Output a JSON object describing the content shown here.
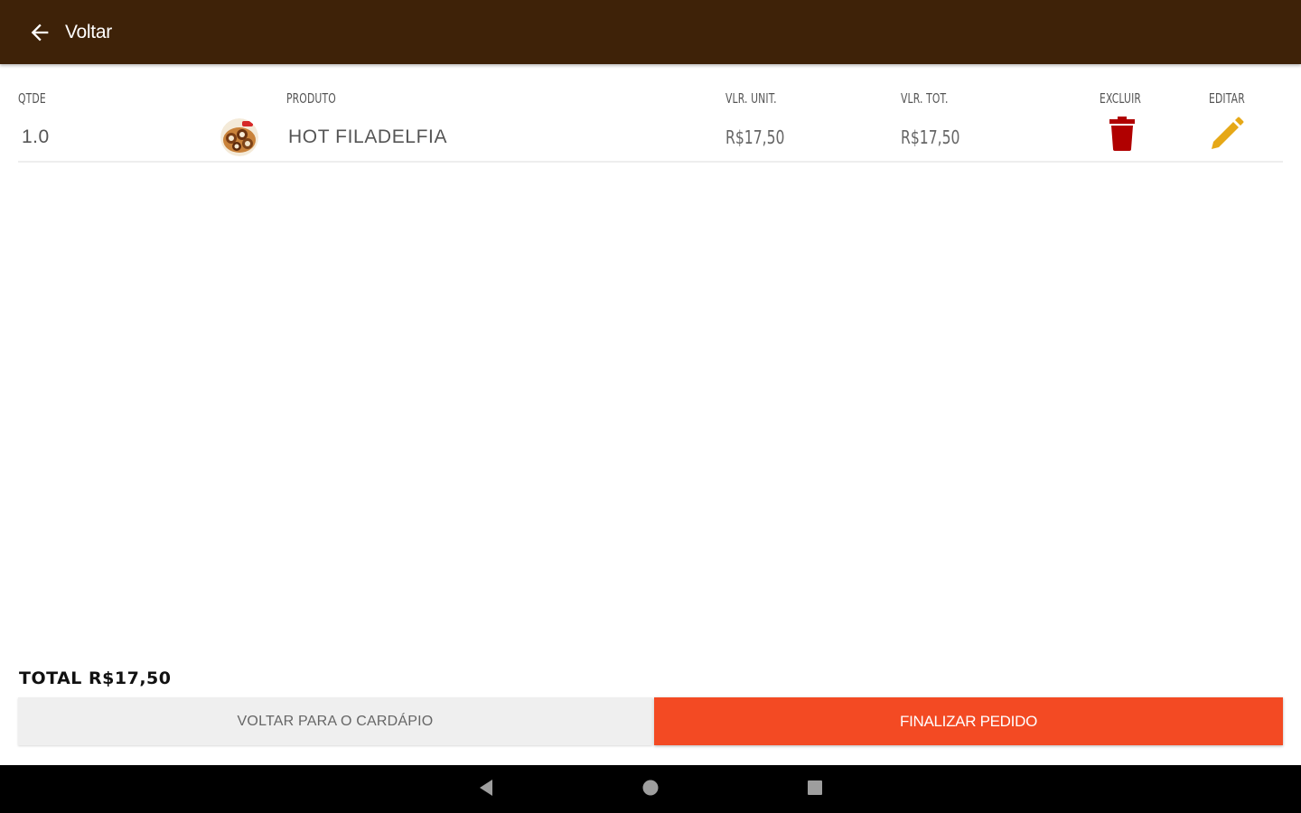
{
  "app_bar": {
    "back_label": "Voltar",
    "background_color": "#3e2208"
  },
  "table": {
    "headers": {
      "qty": "QTDE",
      "product": "PRODUTO",
      "unit_price": "VLR. UNIT.",
      "total_price": "VLR. TOT.",
      "delete": "EXCLUIR",
      "edit": "EDITAR"
    },
    "rows": [
      {
        "qty": "1.0",
        "product": "HOT FILADELFIA",
        "unit_price": "R$17,50",
        "total_price": "R$17,50",
        "delete_icon": "trash-icon",
        "edit_icon": "pencil-icon"
      }
    ]
  },
  "footer": {
    "total_label": "TOTAL R$17,50",
    "back_to_menu_label": "VOLTAR PARA O CARDÁPIO",
    "finish_order_label": "FINALIZAR PEDIDO"
  },
  "colors": {
    "delete": "#b00000",
    "edit": "#e6a817",
    "finish_button": "#f34a23",
    "secondary_button": "#efefef"
  },
  "system_nav": {
    "back_icon": "nav-back-icon",
    "home_icon": "nav-home-icon",
    "recents_icon": "nav-recents-icon"
  }
}
